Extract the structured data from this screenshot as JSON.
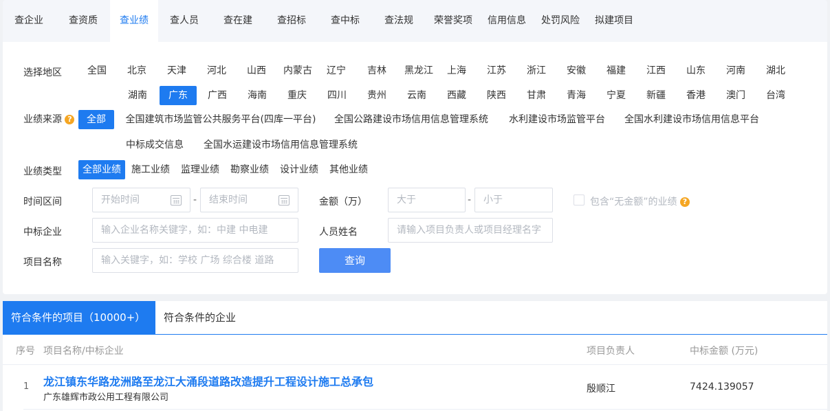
{
  "nav": {
    "tabs": [
      "查企业",
      "查资质",
      "查业绩",
      "查人员",
      "查在建",
      "查招标",
      "查中标",
      "查法规",
      "荣誉奖项",
      "信用信息",
      "处罚风险",
      "拟建项目"
    ],
    "active_index": 2
  },
  "filter": {
    "region_label": "选择地区",
    "regions": [
      "全国",
      "北京",
      "天津",
      "河北",
      "山西",
      "内蒙古",
      "辽宁",
      "吉林",
      "黑龙江",
      "上海",
      "江苏",
      "浙江",
      "安徽",
      "福建",
      "江西",
      "山东",
      "河南",
      "湖北",
      "湖南",
      "广东",
      "广西",
      "海南",
      "重庆",
      "四川",
      "贵州",
      "云南",
      "西藏",
      "陕西",
      "甘肃",
      "青海",
      "宁夏",
      "新疆",
      "香港",
      "澳门",
      "台湾"
    ],
    "selected_region": "广东",
    "source_label": "业绩来源",
    "sources": [
      "全部",
      "全国建筑市场监管公共服务平台(四库一平台)",
      "全国公路建设市场信用信息管理系统",
      "水利建设市场监管平台",
      "全国水利建设市场信用信息平台",
      "中标成交信息",
      "全国水运建设市场信用信息管理系统"
    ],
    "selected_source": "全部",
    "type_label": "业绩类型",
    "types": [
      "全部业绩",
      "施工业绩",
      "监理业绩",
      "勘察业绩",
      "设计业绩",
      "其他业绩"
    ],
    "selected_type": "全部业绩",
    "time_label": "时间区间",
    "start_placeholder": "开始时间",
    "end_placeholder": "结束时间",
    "amount_label": "金额（万）",
    "min_placeholder": "大于",
    "max_placeholder": "小于",
    "include_zero_label": "包含“无金额”的业绩",
    "winner_label": "中标企业",
    "winner_placeholder": "输入企业名称关键字，如：中建 中电建",
    "person_label": "人员姓名",
    "person_placeholder": "请输入项目负责人或项目经理名字",
    "project_label": "项目名称",
    "project_placeholder": "输入关键字，如：学校 广场 综合楼 道路",
    "search_button": "查询",
    "dash": "-",
    "help_glyph": "?"
  },
  "results": {
    "tab_projects": "符合条件的项目（10000+）",
    "tab_companies": "符合条件的企业",
    "columns": {
      "index": "序号",
      "name": "项目名称/中标企业",
      "manager": "项目负责人",
      "amount": "中标金额 (万元)"
    },
    "rows": [
      {
        "index": "1",
        "project": "龙江镇东华路龙洲路至龙江大涌段道路改造提升工程设计施工总承包",
        "company": "广东雄辉市政公用工程有限公司",
        "manager": "殷顺江",
        "amount": "7424.139057"
      }
    ]
  },
  "colors": {
    "accent": "#1e7bf0",
    "button": "#4d8cf5",
    "help": "#f5a623"
  }
}
